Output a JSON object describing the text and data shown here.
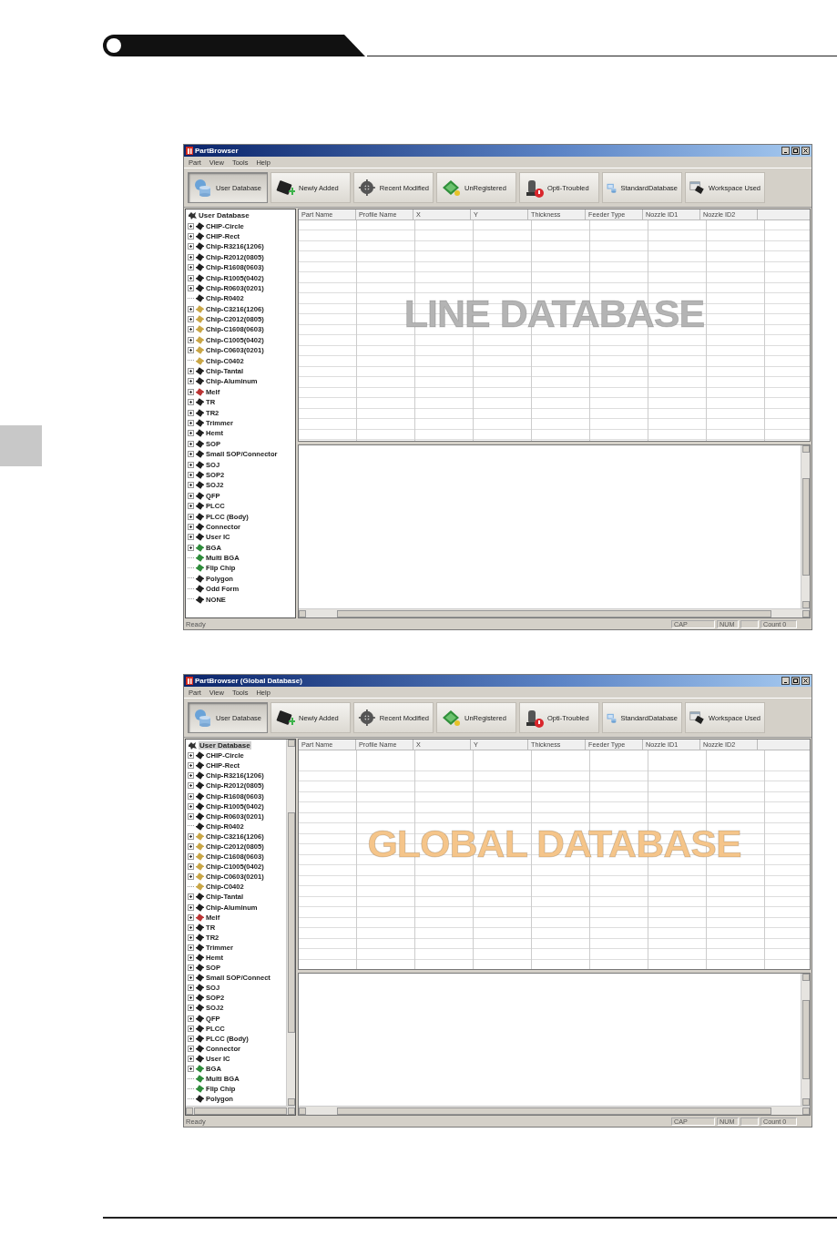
{
  "windows": [
    {
      "title": "PartBrowser",
      "menu": [
        "Part",
        "View",
        "Tools",
        "Help"
      ],
      "toolbar": [
        {
          "label": "User Database",
          "selected": true
        },
        {
          "label": "Newly Added",
          "selected": false
        },
        {
          "label": "Recent Modified",
          "selected": false
        },
        {
          "label": "UnRegistered",
          "selected": false
        },
        {
          "label": "Opti-Troubled",
          "selected": false
        },
        {
          "label": "StandardDatabase",
          "selected": false
        },
        {
          "label": "Workspace Used",
          "selected": false
        }
      ],
      "tree": {
        "scrollbar": false,
        "root": {
          "label": "User Database",
          "selected": false
        },
        "items": [
          {
            "label": "CHIP-Circle",
            "expandable": true
          },
          {
            "label": "CHIP-Rect",
            "expandable": true
          },
          {
            "label": "Chip-R3216(1206)",
            "expandable": true
          },
          {
            "label": "Chip-R2012(0805)",
            "expandable": true
          },
          {
            "label": "Chip-R1608(0603)",
            "expandable": true
          },
          {
            "label": "Chip-R1005(0402)",
            "expandable": true
          },
          {
            "label": "Chip-R0603(0201)",
            "expandable": true
          },
          {
            "label": "Chip-R0402",
            "expandable": false
          },
          {
            "label": "Chip-C3216(1206)",
            "expandable": true
          },
          {
            "label": "Chip-C2012(0805)",
            "expandable": true
          },
          {
            "label": "Chip-C1608(0603)",
            "expandable": true
          },
          {
            "label": "Chip-C1005(0402)",
            "expandable": true
          },
          {
            "label": "Chip-C0603(0201)",
            "expandable": true
          },
          {
            "label": "Chip-C0402",
            "expandable": false
          },
          {
            "label": "Chip-Tantal",
            "expandable": true
          },
          {
            "label": "Chip-Aluminum",
            "expandable": true
          },
          {
            "label": "Melf",
            "expandable": true
          },
          {
            "label": "TR",
            "expandable": true
          },
          {
            "label": "TR2",
            "expandable": true
          },
          {
            "label": "Trimmer",
            "expandable": true
          },
          {
            "label": "Hemt",
            "expandable": true
          },
          {
            "label": "SOP",
            "expandable": true
          },
          {
            "label": "Small SOP/Connector",
            "expandable": true
          },
          {
            "label": "SOJ",
            "expandable": true
          },
          {
            "label": "SOP2",
            "expandable": true
          },
          {
            "label": "SOJ2",
            "expandable": true
          },
          {
            "label": "QFP",
            "expandable": true
          },
          {
            "label": "PLCC",
            "expandable": true
          },
          {
            "label": "PLCC (Body)",
            "expandable": true
          },
          {
            "label": "Connector",
            "expandable": true
          },
          {
            "label": "User IC",
            "expandable": true
          },
          {
            "label": "BGA",
            "expandable": true
          },
          {
            "label": "Multi BGA",
            "expandable": false
          },
          {
            "label": "Flip Chip",
            "expandable": false
          },
          {
            "label": "Polygon",
            "expandable": false
          },
          {
            "label": "Odd Form",
            "expandable": false
          },
          {
            "label": "NONE",
            "expandable": false
          }
        ]
      },
      "table": {
        "columns": [
          "Part Name",
          "Profile Name",
          "X",
          "Y",
          "Thickness",
          "Feeder Type",
          "Nozzle ID1",
          "Nozzle ID2"
        ]
      },
      "overlay_label": {
        "text": "LINE DATABASE",
        "color": "#b4b4b4"
      },
      "status_bar": {
        "message": "Ready",
        "indicators": [
          "CAP",
          "NUM",
          "Count 0"
        ]
      }
    },
    {
      "title": "PartBrowser (Global Database)",
      "menu": [
        "Part",
        "View",
        "Tools",
        "Help"
      ],
      "toolbar": [
        {
          "label": "User Database",
          "selected": true
        },
        {
          "label": "Newly Added",
          "selected": false
        },
        {
          "label": "Recent Modified",
          "selected": false
        },
        {
          "label": "UnRegistered",
          "selected": false
        },
        {
          "label": "Opti-Troubled",
          "selected": false
        },
        {
          "label": "StandardDatabase",
          "selected": false
        },
        {
          "label": "Workspace Used",
          "selected": false
        }
      ],
      "tree": {
        "scrollbar": true,
        "root": {
          "label": "User Database",
          "selected": true
        },
        "items": [
          {
            "label": "CHIP-Circle",
            "expandable": true
          },
          {
            "label": "CHIP-Rect",
            "expandable": true
          },
          {
            "label": "Chip-R3216(1206)",
            "expandable": true
          },
          {
            "label": "Chip-R2012(0805)",
            "expandable": true
          },
          {
            "label": "Chip-R1608(0603)",
            "expandable": true
          },
          {
            "label": "Chip-R1005(0402)",
            "expandable": true
          },
          {
            "label": "Chip-R0603(0201)",
            "expandable": true
          },
          {
            "label": "Chip-R0402",
            "expandable": false
          },
          {
            "label": "Chip-C3216(1206)",
            "expandable": true
          },
          {
            "label": "Chip-C2012(0805)",
            "expandable": true
          },
          {
            "label": "Chip-C1608(0603)",
            "expandable": true
          },
          {
            "label": "Chip-C1005(0402)",
            "expandable": true
          },
          {
            "label": "Chip-C0603(0201)",
            "expandable": true
          },
          {
            "label": "Chip-C0402",
            "expandable": false
          },
          {
            "label": "Chip-Tantal",
            "expandable": true
          },
          {
            "label": "Chip-Aluminum",
            "expandable": true
          },
          {
            "label": "Melf",
            "expandable": true
          },
          {
            "label": "TR",
            "expandable": true
          },
          {
            "label": "TR2",
            "expandable": true
          },
          {
            "label": "Trimmer",
            "expandable": true
          },
          {
            "label": "Hemt",
            "expandable": true
          },
          {
            "label": "SOP",
            "expandable": true
          },
          {
            "label": "Small SOP/Connect",
            "expandable": true
          },
          {
            "label": "SOJ",
            "expandable": true
          },
          {
            "label": "SOP2",
            "expandable": true
          },
          {
            "label": "SOJ2",
            "expandable": true
          },
          {
            "label": "QFP",
            "expandable": true
          },
          {
            "label": "PLCC",
            "expandable": true
          },
          {
            "label": "PLCC (Body)",
            "expandable": true
          },
          {
            "label": "Connector",
            "expandable": true
          },
          {
            "label": "User IC",
            "expandable": true
          },
          {
            "label": "BGA",
            "expandable": true
          },
          {
            "label": "Multi BGA",
            "expandable": false
          },
          {
            "label": "Flip Chip",
            "expandable": false
          },
          {
            "label": "Polygon",
            "expandable": false
          }
        ]
      },
      "table": {
        "columns": [
          "Part Name",
          "Profile Name",
          "X",
          "Y",
          "Thickness",
          "Feeder Type",
          "Nozzle ID1",
          "Nozzle ID2"
        ]
      },
      "overlay_label": {
        "text": "GLOBAL DATABASE",
        "color": "#f5c58a"
      },
      "status_bar": {
        "message": "Ready",
        "indicators": [
          "CAP",
          "NUM",
          "Count 0"
        ]
      }
    }
  ]
}
